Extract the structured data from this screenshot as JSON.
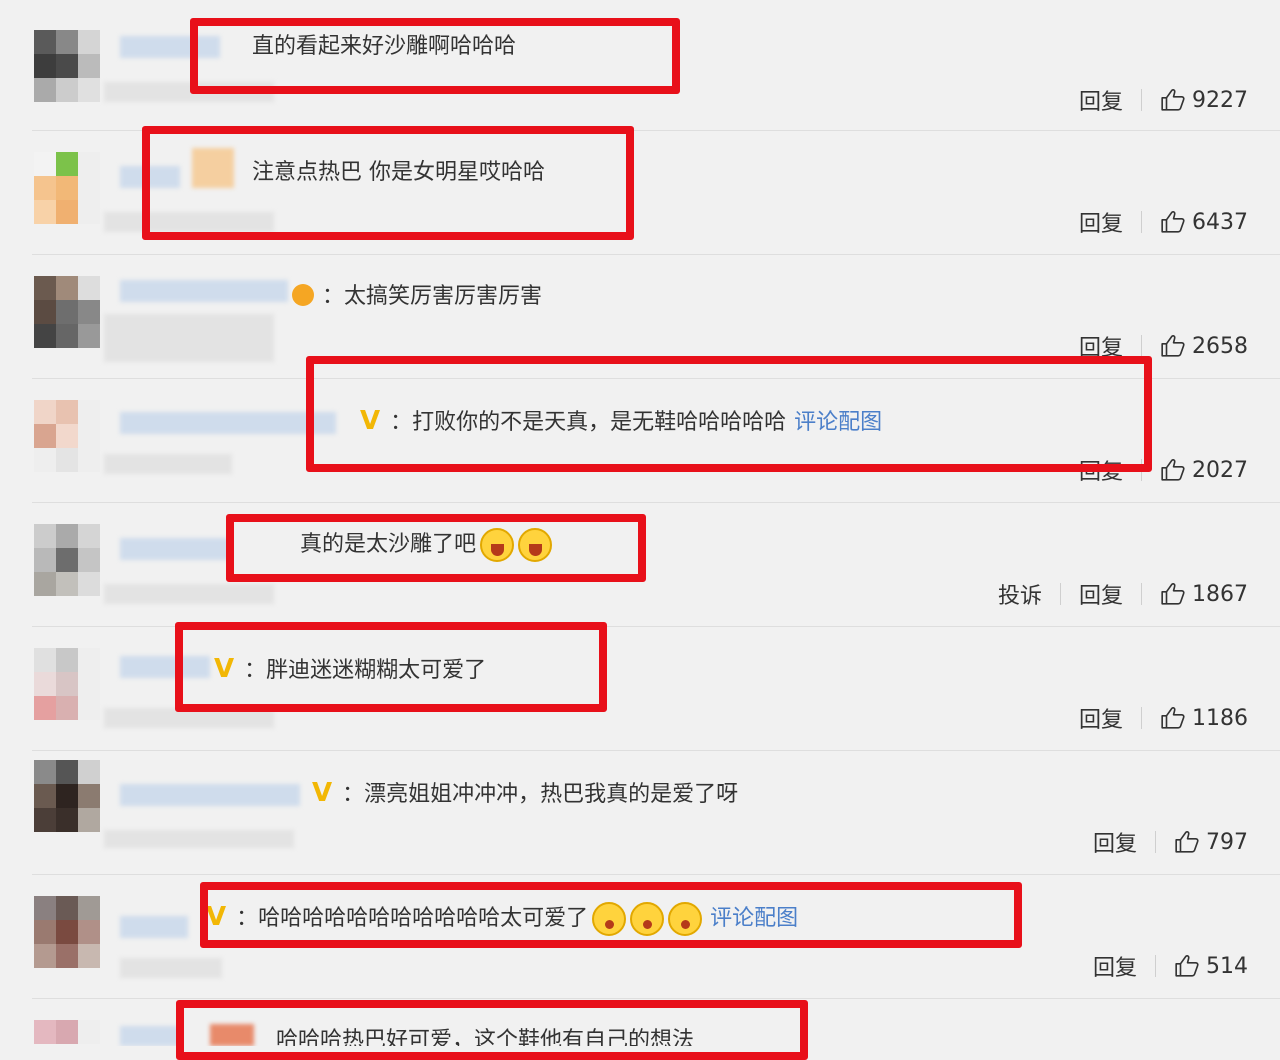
{
  "comments": [
    {
      "text": "直的看起来好沙雕啊哈哈哈",
      "actions": {
        "reply": "回复",
        "likes": "9227"
      }
    },
    {
      "text": "注意点热巴 你是女明星哎哈哈",
      "actions": {
        "reply": "回复",
        "likes": "6437"
      }
    },
    {
      "text": "太搞笑厉害厉害厉害",
      "actions": {
        "reply": "回复",
        "likes": "2658"
      }
    },
    {
      "text": "打败你的不是天真，是无鞋哈哈哈哈哈",
      "link": "评论配图",
      "actions": {
        "reply": "回复",
        "likes": "2027"
      }
    },
    {
      "text": "真的是太沙雕了吧",
      "actions": {
        "report": "投诉",
        "reply": "回复",
        "likes": "1867"
      }
    },
    {
      "text": "胖迪迷迷糊糊太可爱了",
      "actions": {
        "reply": "回复",
        "likes": "1186"
      }
    },
    {
      "text": "漂亮姐姐冲冲冲，热巴我真的是爱了呀",
      "actions": {
        "reply": "回复",
        "likes": "797"
      }
    },
    {
      "text": "哈哈哈哈哈哈哈哈哈哈哈太可爱了",
      "link": "评论配图",
      "actions": {
        "reply": "回复",
        "likes": "514"
      }
    },
    {
      "text": "哈哈哈热巴好可爱，这个鞋他有自己的想法"
    }
  ],
  "badges": {
    "vip": "V",
    "colon": "："
  },
  "icons": {
    "like": "thumbs-up-icon",
    "emoji_laugh": "laughing-emoji-icon",
    "emoji_shy": "shy-emoji-icon"
  },
  "colors": {
    "highlight": "#e8101a",
    "link": "#4b7fc9",
    "vip": "#f2b705",
    "background": "#f1f1f1"
  }
}
